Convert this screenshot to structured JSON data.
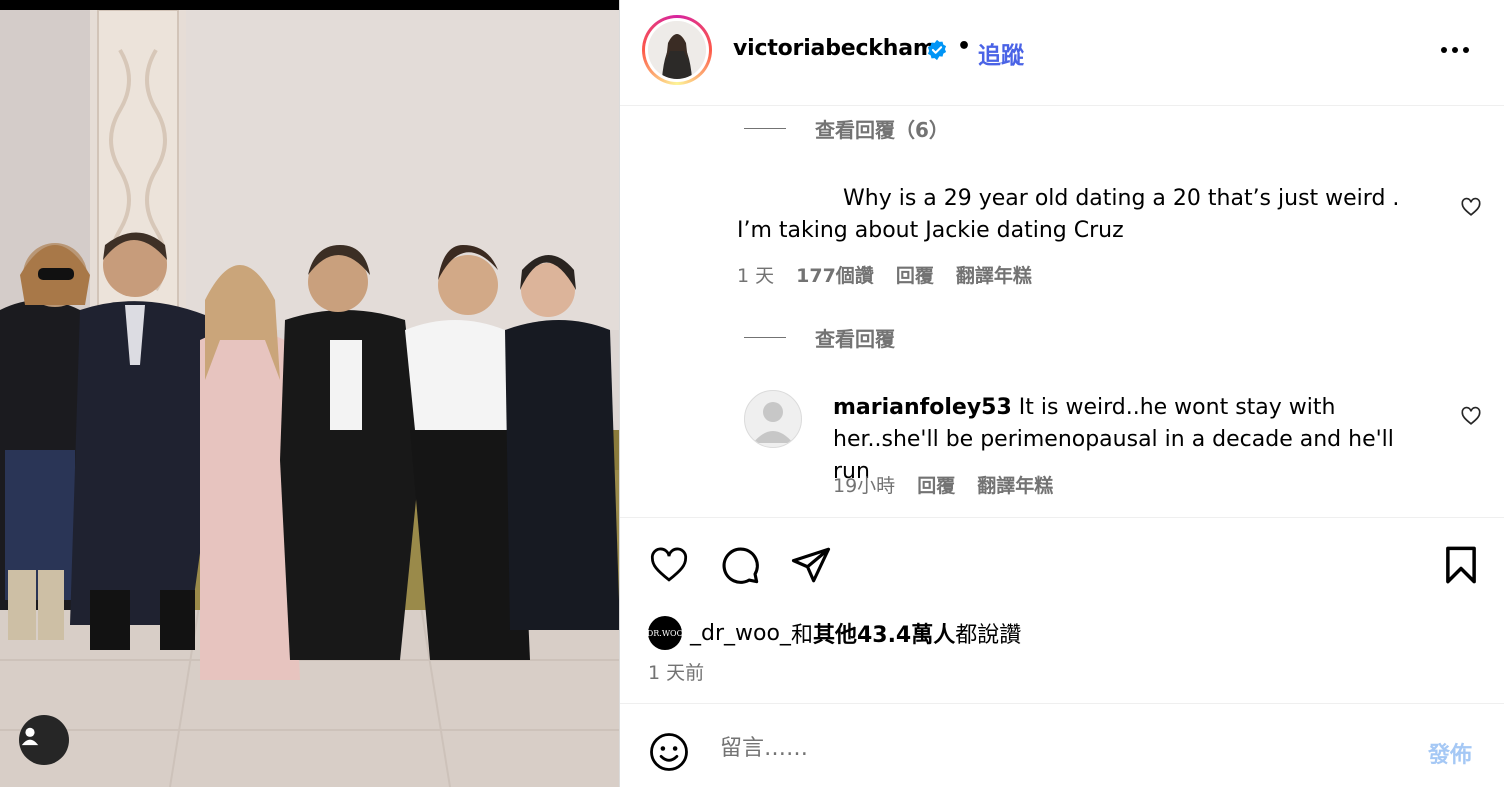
{
  "post": {
    "username": "victoriabeckham",
    "dot": "•",
    "follow_label": "追蹤"
  },
  "comments": {
    "view_replies_1": "查看回覆（6）",
    "comment1": {
      "text": "Why is a 29 year old dating a 20 that’s just weird . I’m taking about Jackie dating Cruz",
      "time": "1 天",
      "likes": "177個讚",
      "reply": "回覆",
      "translate": "翻譯年糕"
    },
    "view_replies_2": "查看回覆",
    "comment2": {
      "username": "marianfoley53",
      "text": "It is weird..he wont stay with her..she'll be perimenopausal in a decade and he'll run",
      "time": "19小時",
      "reply": "回覆",
      "translate": "翻譯年糕"
    }
  },
  "likes": {
    "avatar_text": "DR.WOO",
    "user": "_dr_woo_",
    "and": "和",
    "others": "其他43.4萬人",
    "suffix": "都說讚",
    "time_ago": "1 天前"
  },
  "composer": {
    "placeholder": "留言……",
    "post_label": "發佈"
  },
  "colors": {
    "link_blue": "#4a63e6",
    "verified_blue": "#0095f6",
    "muted_gray": "#737373",
    "post_disabled": "#a5c8f5"
  },
  "icons": [
    "verified-badge-icon",
    "more-options-icon",
    "heart-icon",
    "comment-icon",
    "share-icon",
    "bookmark-icon",
    "emoji-icon",
    "user-tag-icon"
  ]
}
